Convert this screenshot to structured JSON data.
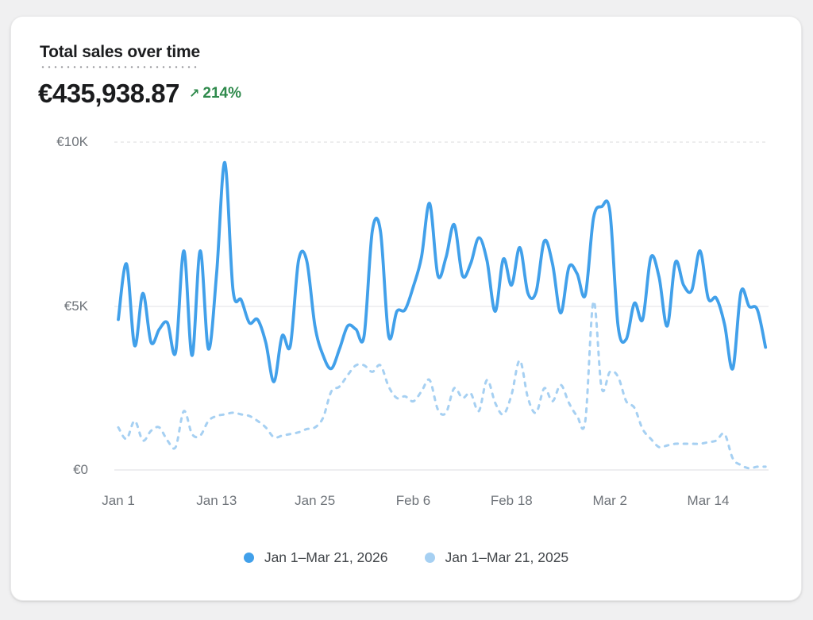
{
  "header": {
    "title": "Total sales over time",
    "total_value": "€435,938.87",
    "change_arrow": "↗",
    "change_percent": "214%"
  },
  "colors": {
    "accent_blue": "#41a0ea",
    "light_blue": "#a6d0f2",
    "positive_green": "#2f8a4c",
    "axis_text": "#6e7379",
    "gridline": "#ececee"
  },
  "chart_data": {
    "type": "line",
    "title": "Total sales over time",
    "xlabel": "",
    "ylabel": "",
    "x_unit": "day",
    "x_start": "Jan 1",
    "x_end": "Mar 21",
    "ylim": [
      0,
      10000
    ],
    "grid": true,
    "legend_position": "bottom",
    "y_ticks": [
      {
        "label": "€10K",
        "value": 10000
      },
      {
        "label": "€5K",
        "value": 5000
      },
      {
        "label": "€0",
        "value": 0
      }
    ],
    "x_ticks": [
      {
        "label": "Jan 1",
        "day": 0
      },
      {
        "label": "Jan 13",
        "day": 12
      },
      {
        "label": "Jan 25",
        "day": 24
      },
      {
        "label": "Feb 6",
        "day": 36
      },
      {
        "label": "Feb 18",
        "day": 48
      },
      {
        "label": "Mar 2",
        "day": 60
      },
      {
        "label": "Mar 14",
        "day": 72
      }
    ],
    "series": [
      {
        "name": "Jan 1–Mar 21, 2026",
        "style": "solid",
        "color": "#41a0ea",
        "values_eur": [
          4600,
          6300,
          3800,
          5400,
          3900,
          4300,
          4500,
          3600,
          6700,
          3500,
          6700,
          3700,
          6000,
          9400,
          5500,
          5200,
          4500,
          4600,
          3900,
          2700,
          4100,
          3800,
          6400,
          6400,
          4400,
          3500,
          3100,
          3700,
          4400,
          4300,
          4100,
          7300,
          7300,
          4100,
          4850,
          4900,
          5600,
          6500,
          8150,
          5950,
          6500,
          7500,
          5950,
          6300,
          7100,
          6400,
          4850,
          6450,
          5650,
          6800,
          5400,
          5450,
          7000,
          6300,
          4800,
          6200,
          6000,
          5350,
          7700,
          8050,
          7900,
          4400,
          4000,
          5100,
          4600,
          6500,
          5900,
          4400,
          6350,
          5650,
          5500,
          6700,
          5250,
          5250,
          4450,
          3100,
          5450,
          5000,
          4900,
          3750
        ]
      },
      {
        "name": "Jan 1–Mar 21, 2025",
        "style": "dashed",
        "color": "#a6d0f2",
        "values_eur": [
          1300,
          950,
          1500,
          900,
          1200,
          1300,
          900,
          700,
          1800,
          1100,
          1050,
          1500,
          1650,
          1700,
          1750,
          1700,
          1650,
          1500,
          1300,
          1000,
          1050,
          1100,
          1150,
          1250,
          1300,
          1600,
          2400,
          2550,
          2900,
          3200,
          3200,
          3000,
          3200,
          2550,
          2200,
          2250,
          2100,
          2400,
          2750,
          1850,
          1750,
          2500,
          2200,
          2350,
          1800,
          2750,
          2050,
          1700,
          2300,
          3350,
          2200,
          1750,
          2500,
          2100,
          2600,
          2050,
          1650,
          1500,
          5150,
          2500,
          3000,
          2850,
          2100,
          1900,
          1250,
          950,
          700,
          750,
          800,
          800,
          800,
          800,
          850,
          900,
          1100,
          350,
          150,
          50,
          100,
          100
        ]
      }
    ]
  }
}
